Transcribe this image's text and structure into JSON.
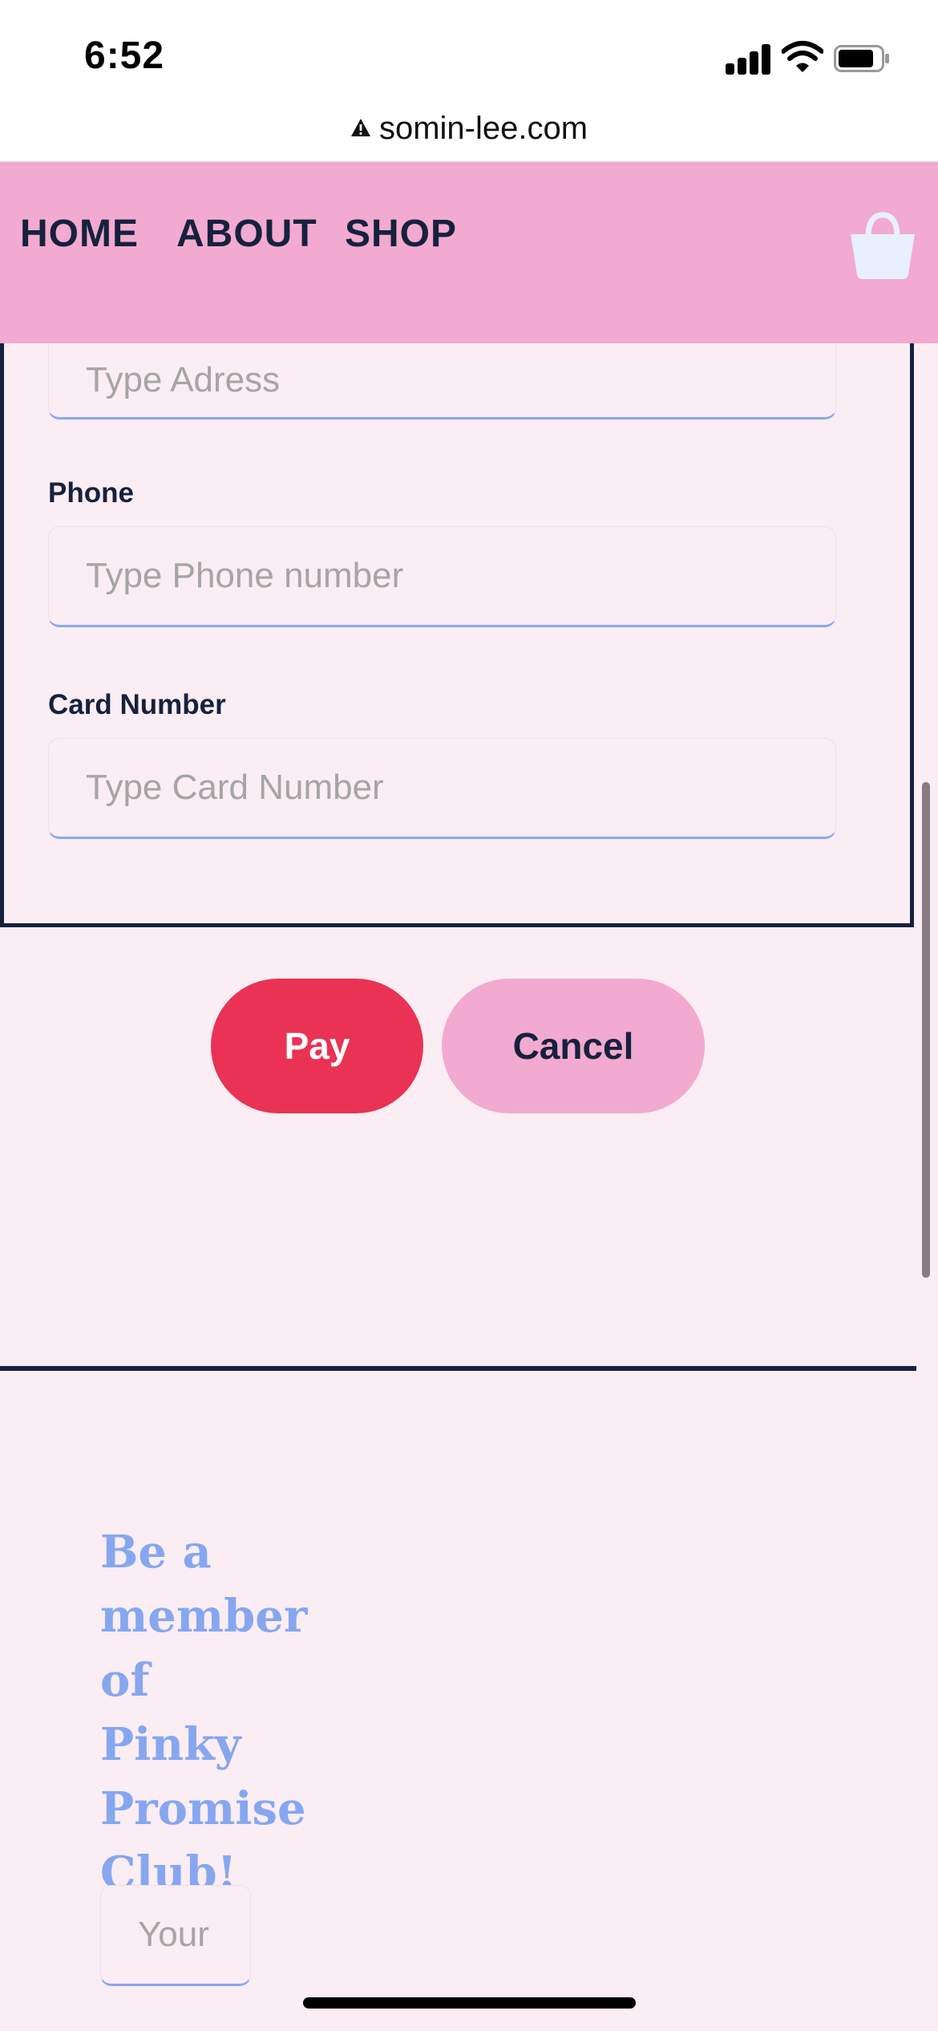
{
  "status_bar": {
    "time": "6:52"
  },
  "browser": {
    "url": "somin-lee.com"
  },
  "nav": {
    "home": "HOME",
    "about": "ABOUT",
    "shop": "SHOP"
  },
  "form": {
    "address": {
      "placeholder": "Type Adress"
    },
    "phone": {
      "label": "Phone",
      "placeholder": "Type Phone number"
    },
    "card": {
      "label": "Card Number",
      "placeholder": "Type Card Number"
    }
  },
  "buttons": {
    "pay": "Pay",
    "cancel": "Cancel"
  },
  "newsletter": {
    "title": "Be a member of Pinky Promise Club!",
    "input_placeholder": "Your"
  },
  "icons": {
    "status": [
      "signal-icon",
      "wifi-icon",
      "battery-icon"
    ],
    "url": "warning-icon",
    "header": "shopping-bag-icon"
  },
  "colors": {
    "header_pink": "#f2aad0",
    "page_bg": "#faedf4",
    "navy": "#16213d",
    "pay_red": "#ea3254",
    "accent_blue": "#86a7ef"
  }
}
